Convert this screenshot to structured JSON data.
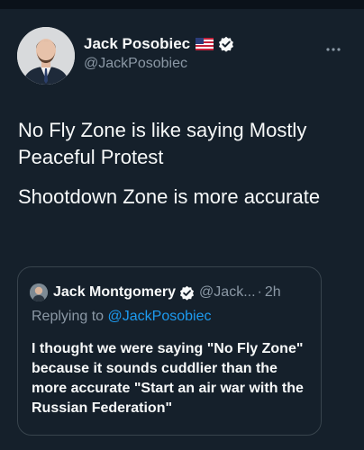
{
  "tweet": {
    "author": {
      "name": "Jack Posobiec",
      "handle": "@JackPosobiec",
      "flag_icon": "us-flag-icon",
      "verified_icon": "verified-badge-icon"
    },
    "more_icon": "more-options-icon",
    "text": [
      "No Fly Zone is like saying Mostly Peaceful Protest",
      "Shootdown Zone is more accurate"
    ]
  },
  "quote": {
    "author": {
      "name": "Jack Montgomery",
      "handle": "@Jack...",
      "verified_icon": "verified-badge-icon"
    },
    "separator": "·",
    "time": "2h",
    "replying_to_label": "Replying to",
    "replying_to_handle": "@JackPosobiec",
    "text": "I thought we were saying \"No Fly Zone\" because it sounds cuddlier than the more accurate \"Start an air war with the Russian Federation\""
  },
  "colors": {
    "background": "#15202b",
    "text": "#f7f9f9",
    "secondary_text": "#8b98a5",
    "link": "#1d9bf0",
    "border": "#38444d"
  }
}
